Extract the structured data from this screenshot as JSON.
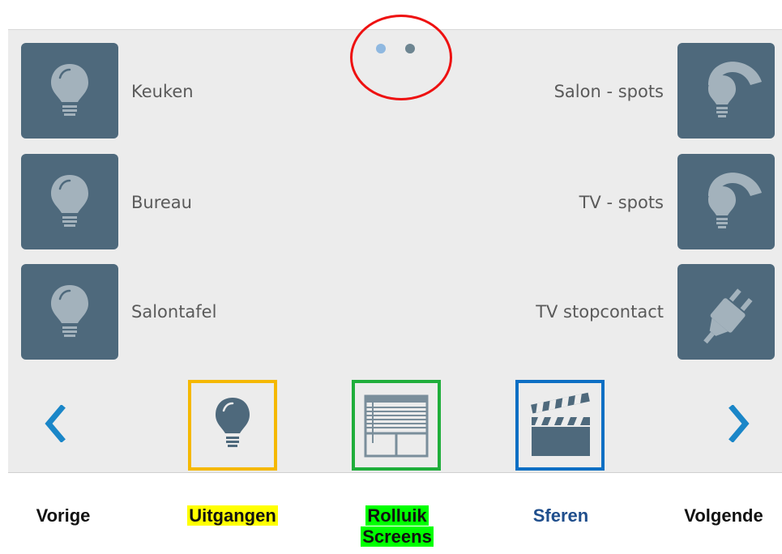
{
  "pager": {
    "pages": 2,
    "current": 1
  },
  "outputs_left": [
    {
      "label": "Keuken",
      "icon": "lightbulb-icon"
    },
    {
      "label": "Bureau",
      "icon": "lightbulb-icon"
    },
    {
      "label": "Salontafel",
      "icon": "lightbulb-icon"
    }
  ],
  "outputs_right": [
    {
      "label": "Salon - spots",
      "icon": "dimmable-lightbulb-icon"
    },
    {
      "label": "TV - spots",
      "icon": "dimmable-lightbulb-icon"
    },
    {
      "label": "TV stopcontact",
      "icon": "power-plug-icon"
    }
  ],
  "bottom_bar": {
    "prev_icon": "chevron-left-icon",
    "next_icon": "chevron-right-icon",
    "categories": [
      {
        "icon": "lightbulb-icon",
        "border_color": "#f5b800"
      },
      {
        "icon": "window-blind-icon",
        "border_color": "#1fae3b"
      },
      {
        "icon": "clapperboard-icon",
        "border_color": "#0d6fc4"
      }
    ]
  },
  "annotations": {
    "circle_color": "#ee1111",
    "labels": {
      "prev": "Vorige",
      "outputs": "Uitgangen",
      "blinds_line1": "Rolluik",
      "blinds_line2": "Screens",
      "scenes": "Sferen",
      "next": "Volgende"
    },
    "outputs_highlight": "#ffff00",
    "blinds_highlight": "#00ff00",
    "scenes_color": "#1f4e8c"
  }
}
